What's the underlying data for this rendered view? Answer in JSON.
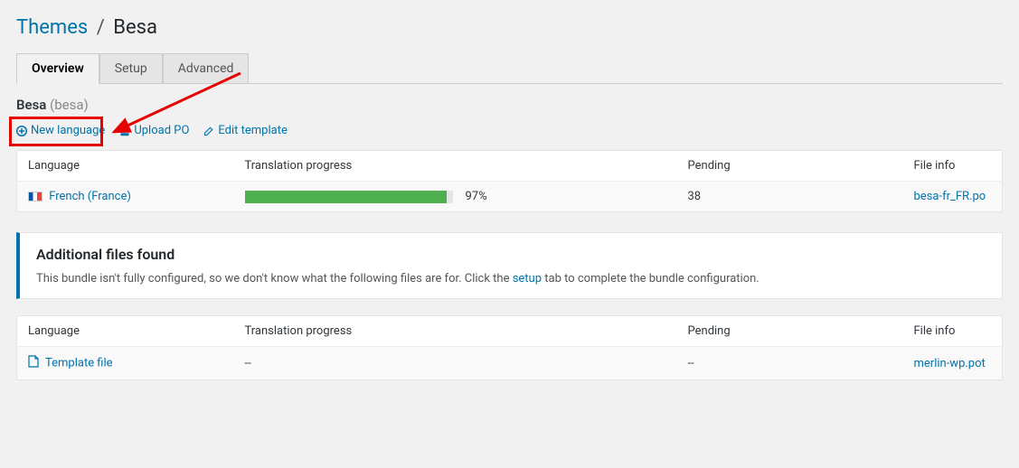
{
  "breadcrumb": {
    "root": "Themes",
    "separator": "/",
    "current": "Besa"
  },
  "tabs": [
    {
      "label": "Overview",
      "active": true
    },
    {
      "label": "Setup",
      "active": false
    },
    {
      "label": "Advanced",
      "active": false
    }
  ],
  "bundle": {
    "name": "Besa",
    "slug": "(besa)"
  },
  "toolbar": {
    "new_language": "New language",
    "upload_po": "Upload PO",
    "edit_template": "Edit template"
  },
  "table_headers": {
    "language": "Language",
    "progress": "Translation progress",
    "pending": "Pending",
    "file_info": "File info"
  },
  "languages": [
    {
      "name": "French (France)",
      "progress_percent": 97,
      "progress_label": "97%",
      "pending": "38",
      "file": "besa-fr_FR.po"
    }
  ],
  "notice": {
    "title": "Additional files found",
    "text_pre": "This bundle isn't fully configured, so we don't know what the following files are for. Click the ",
    "link": "setup",
    "text_post": " tab to complete the bundle configuration."
  },
  "extra_files": [
    {
      "name": "Template file",
      "progress": "--",
      "pending": "--",
      "file": "merlin-wp.pot"
    }
  ],
  "colors": {
    "link": "#0073aa",
    "progress": "#4caf50",
    "highlight": "#e60000"
  }
}
